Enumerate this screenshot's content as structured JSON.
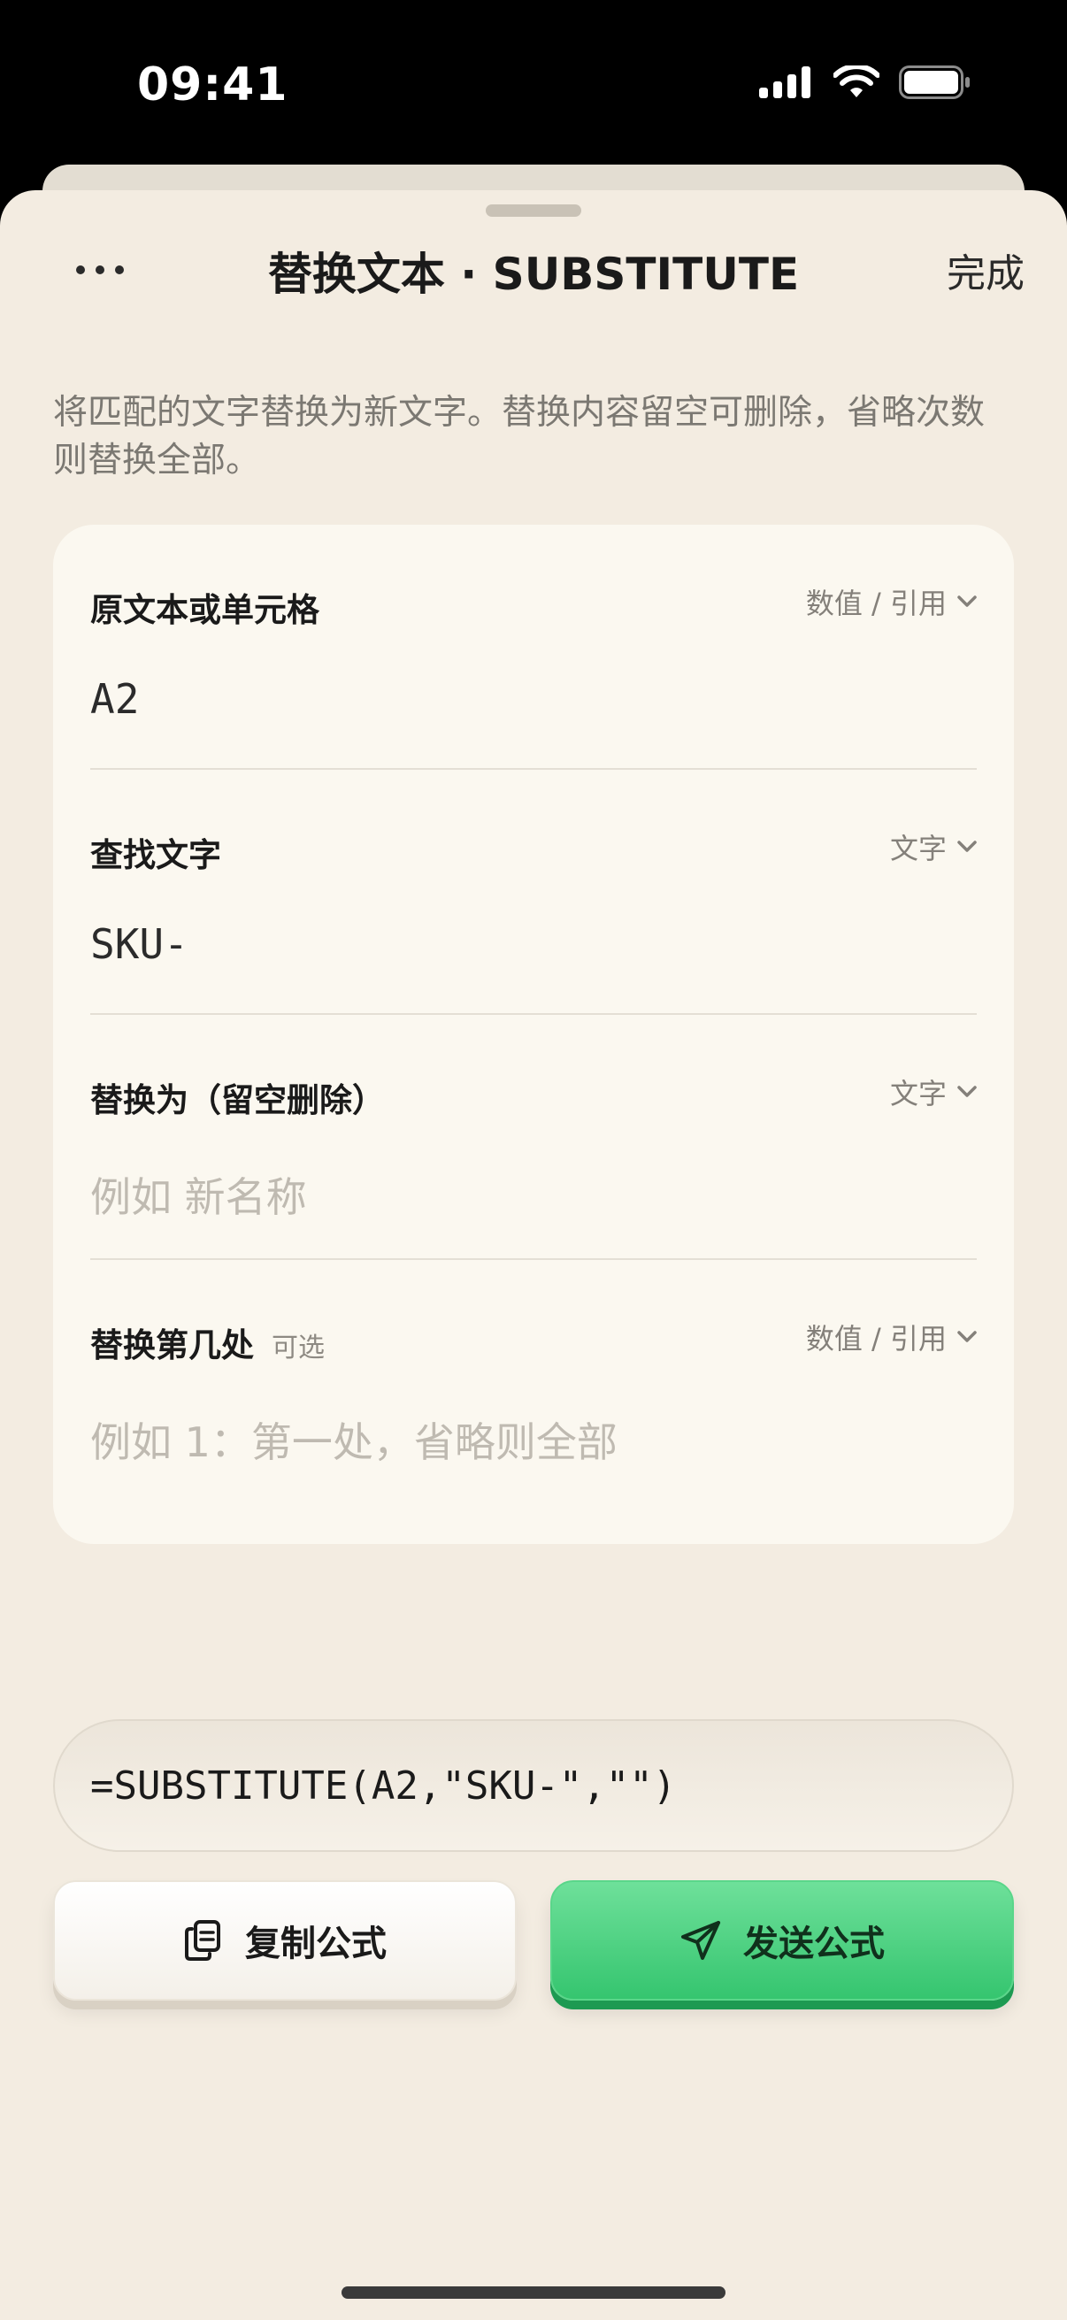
{
  "status_bar": {
    "time": "09:41"
  },
  "sheet": {
    "title": "替换文本 · SUBSTITUTE",
    "done_label": "完成",
    "description": "将匹配的文字替换为新文字。替换内容留空可删除，省略次数则替换全部。"
  },
  "fields": [
    {
      "label": "原文本或单元格",
      "type": "数值 / 引用",
      "value": "A2",
      "placeholder": ""
    },
    {
      "label": "查找文字",
      "type": "文字",
      "value": "SKU-",
      "placeholder": ""
    },
    {
      "label": "替换为（留空删除）",
      "type": "文字",
      "value": "",
      "placeholder": "例如  新名称"
    },
    {
      "label": "替换第几处",
      "optional": "可选",
      "type": "数值 / 引用",
      "value": "",
      "placeholder": "例如  1：第一处，省略则全部"
    }
  ],
  "formula": "=SUBSTITUTE(A2,\"SKU-\",\"\")",
  "actions": {
    "copy_label": "复制公式",
    "send_label": "发送公式"
  },
  "colors": {
    "accent": "#35c56f",
    "sheet_bg": "#f3ece1",
    "card_bg": "#fbf8f0"
  }
}
